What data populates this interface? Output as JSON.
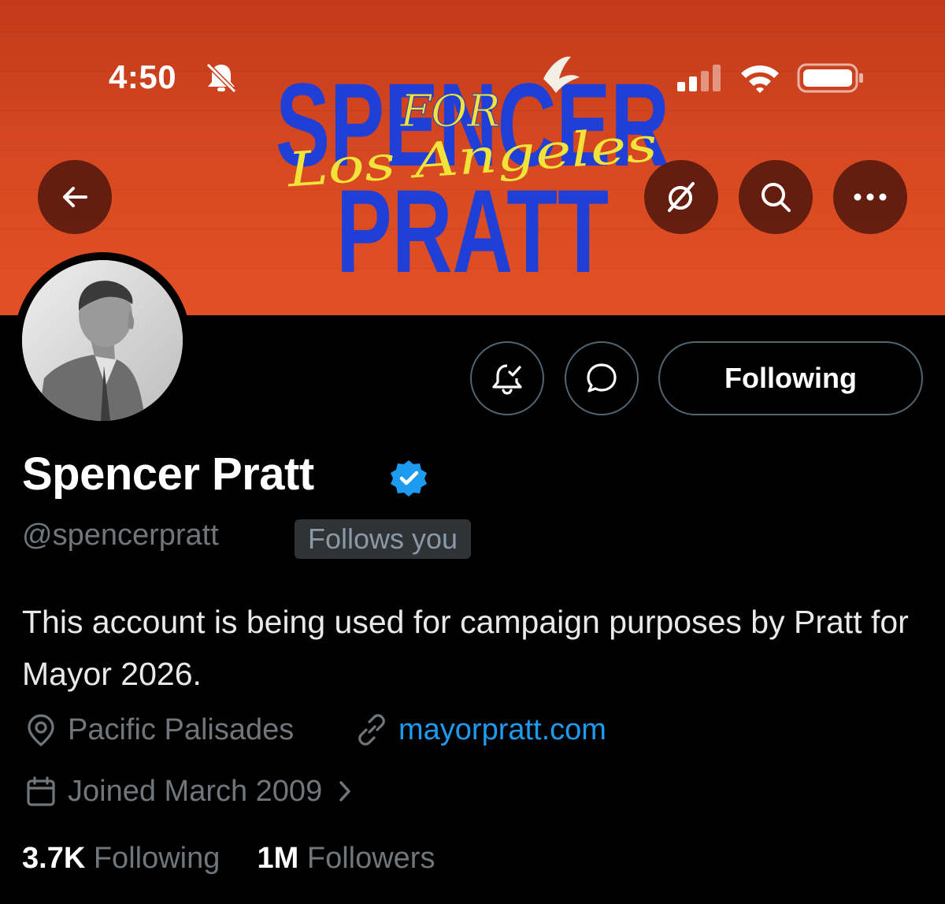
{
  "status_bar": {
    "time": "4:50",
    "silent_icon": "bell-slash-icon",
    "signal_icon": "cellular-signal-icon",
    "wifi_icon": "wifi-icon",
    "battery_icon": "battery-icon"
  },
  "banner": {
    "line1": "SPENCER",
    "line2": "PRATT",
    "script_top": "FOR",
    "script_bottom": "Los Angeles",
    "colors": {
      "background": "#d84a22",
      "headline": "#1f3fd6",
      "script": "#f1e33a"
    }
  },
  "header_actions": {
    "back_icon": "arrow-left-icon",
    "grok_icon": "grok-icon",
    "search_icon": "search-icon",
    "more_icon": "more-horizontal-icon"
  },
  "profile": {
    "display_name": "Spencer Pratt",
    "handle": "@spencerpratt",
    "follows_you": "Follows you",
    "bio": "This account is being used for campaign purposes by Pratt for Mayor 2026.",
    "location": "Pacific Palisades",
    "website": "mayorpratt.com",
    "joined": "Joined March 2009",
    "following_count": "3.7K",
    "following_label": "Following",
    "followers_count": "1M",
    "followers_label": "Followers"
  },
  "actions": {
    "notifications_icon": "bell-check-icon",
    "message_icon": "message-icon",
    "follow_button": "Following"
  },
  "colors": {
    "accent": "#1d9bf0",
    "verified": "#1d9bf0",
    "muted": "#71767b"
  }
}
